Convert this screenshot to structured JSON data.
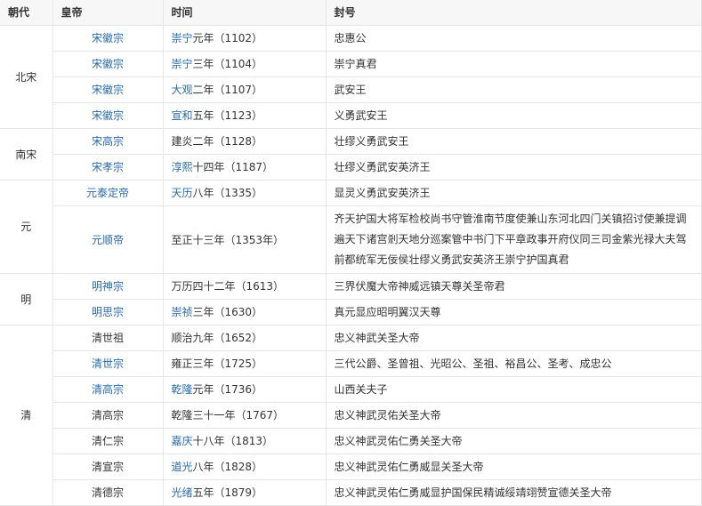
{
  "headers": [
    "朝代",
    "皇帝",
    "时间",
    "封号"
  ],
  "colors": {
    "link": "#2a6aa8",
    "header_bg": "#f7f7f7",
    "border": "#e6e6e6"
  },
  "groups": [
    {
      "dynasty": "北宋",
      "rows": [
        {
          "emperor": "宋徽宗",
          "emperor_link": true,
          "time_link": "崇宁",
          "time_rest": "元年（1102）",
          "title": "忠惠公"
        },
        {
          "emperor": "宋徽宗",
          "emperor_link": true,
          "time_link": "崇宁",
          "time_rest": "三年（1104）",
          "title": "崇宁真君"
        },
        {
          "emperor": "宋徽宗",
          "emperor_link": true,
          "time_link": "大观",
          "time_rest": "二年（1107）",
          "title": "武安王"
        },
        {
          "emperor": "宋徽宗",
          "emperor_link": true,
          "time_link": "宣和",
          "time_rest": "五年（1123）",
          "title": "义勇武安王"
        }
      ]
    },
    {
      "dynasty": "南宋",
      "rows": [
        {
          "emperor": "宋高宗",
          "emperor_link": true,
          "time_link": "",
          "time_rest": "建炎二年（1128）",
          "title": "壮缪义勇武安王"
        },
        {
          "emperor": "宋孝宗",
          "emperor_link": true,
          "time_link": "淳熙",
          "time_rest": "十四年（1187）",
          "title": "壮缪义勇武安英济王"
        }
      ]
    },
    {
      "dynasty": "元",
      "rows": [
        {
          "emperor": "元泰定帝",
          "emperor_link": true,
          "time_link": "天历",
          "time_rest": "八年（1335）",
          "title": "显灵义勇武安英济王"
        },
        {
          "emperor": "元顺帝",
          "emperor_link": true,
          "time_link": "",
          "time_rest": "至正十三年（1353年）",
          "title": "齐天护国大将军检校尚书守管淮南节度使兼山东河北四门关镇招讨使兼提调遍天下诸宫剎天地分巡案管中书门下平章政事开府仪同三司金紫光禄大夫驾前都统军无佞侯壮缪义勇武安英济王崇宁护国真君"
        }
      ]
    },
    {
      "dynasty": "明",
      "rows": [
        {
          "emperor": "明神宗",
          "emperor_link": true,
          "time_link": "",
          "time_rest": "万历四十二年（1613）",
          "title": "三界伏魔大帝神威远镇天尊关圣帝君"
        },
        {
          "emperor": "明思宗",
          "emperor_link": true,
          "time_link": "崇祯",
          "time_rest": "三年（1630）",
          "title": "真元显应昭明翼汉天尊"
        }
      ]
    },
    {
      "dynasty": "清",
      "rows": [
        {
          "emperor": "清世祖",
          "emperor_link": false,
          "time_link": "",
          "time_rest": "顺治九年（1652）",
          "title": "忠义神武关圣大帝"
        },
        {
          "emperor": "清世宗",
          "emperor_link": true,
          "time_link": "",
          "time_rest": "雍正三年（1725）",
          "title": "三代公爵、圣曾祖、光昭公、圣祖、裕昌公、圣考、成忠公"
        },
        {
          "emperor": "清高宗",
          "emperor_link": true,
          "time_link": "乾隆",
          "time_rest": "元年（1736）",
          "title": "山西关夫子"
        },
        {
          "emperor": "清高宗",
          "emperor_link": false,
          "time_link": "",
          "time_rest": "乾隆三十一年（1767）",
          "title": "忠义神武灵佑关圣大帝"
        },
        {
          "emperor": "清仁宗",
          "emperor_link": false,
          "time_link": "嘉庆",
          "time_rest": "十八年（1813）",
          "title": "忠义神武灵佑仁勇关圣大帝"
        },
        {
          "emperor": "清宣宗",
          "emperor_link": false,
          "time_link": "道光",
          "time_rest": "八年（1828）",
          "title": "忠义神武灵佑仁勇威显关圣大帝"
        },
        {
          "emperor": "清德宗",
          "emperor_link": false,
          "time_link": "光绪",
          "time_rest": "五年（1879）",
          "title": "忠义神武灵佑仁勇威显护国保民精诚绥靖翊赞宣德关圣大帝"
        }
      ]
    }
  ]
}
